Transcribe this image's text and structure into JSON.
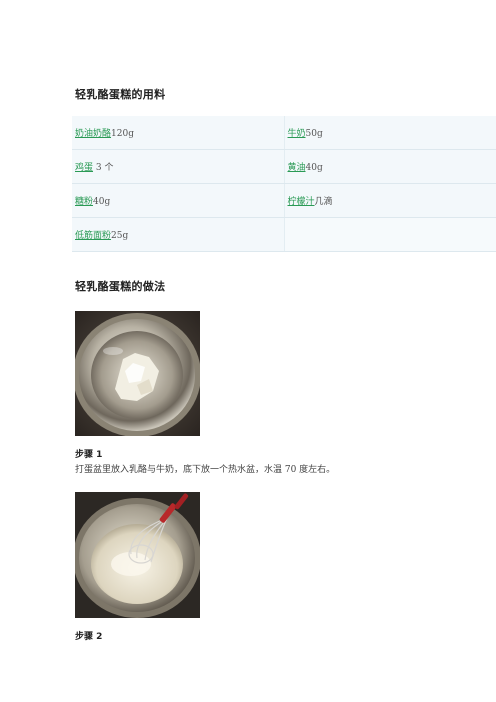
{
  "ingredients_title": "轻乳酪蛋糕的用料",
  "ingredients": [
    {
      "name": "奶油奶酪",
      "amount": "120g"
    },
    {
      "name": "牛奶",
      "amount": "50g"
    },
    {
      "name": "鸡蛋",
      "amount": "3 个"
    },
    {
      "name": "黄油",
      "amount": "40g"
    },
    {
      "name": "糖粉",
      "amount": "40g"
    },
    {
      "name": "柠檬汁",
      "amount": "几滴"
    },
    {
      "name": "低筋面粉",
      "amount": "25g"
    }
  ],
  "method_title": "轻乳酪蛋糕的做法",
  "steps": [
    {
      "label": "步骤 1",
      "text": "打蛋盆里放入乳酪与牛奶，底下放一个热水盆，水温 70 度左右。"
    },
    {
      "label": "步骤 2",
      "text": ""
    }
  ],
  "colors": {
    "link": "#2a9a55",
    "table_bg": "#f3f8fb"
  }
}
